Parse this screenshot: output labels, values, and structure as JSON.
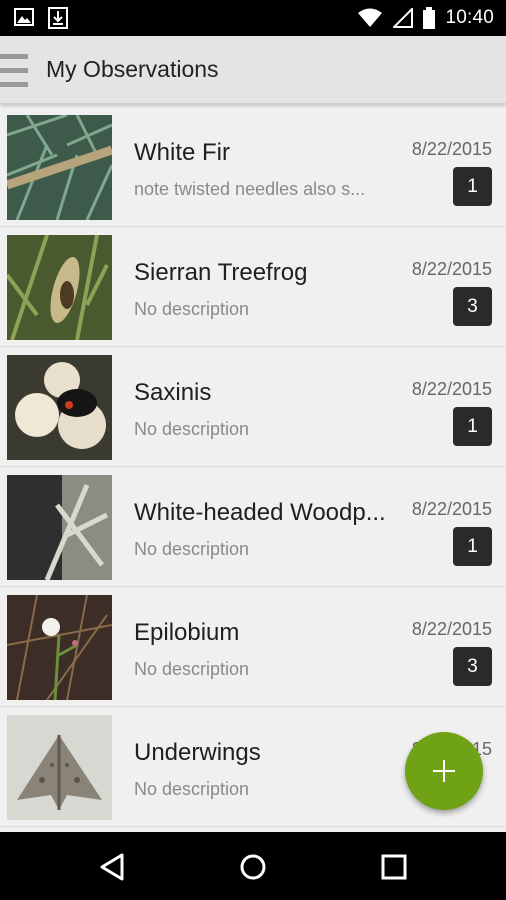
{
  "status_bar": {
    "time": "10:40",
    "left_icons": [
      "image-icon",
      "download-icon"
    ],
    "right_icons": [
      "wifi-icon",
      "signal-icon",
      "battery-icon"
    ]
  },
  "toolbar": {
    "title": "My Observations",
    "menu_icon": "hamburger-menu-icon"
  },
  "observations": [
    {
      "name": "White Fir",
      "description": "note twisted needles also s...",
      "date": "8/22/2015",
      "count": "1"
    },
    {
      "name": "Sierran Treefrog",
      "description": "No description",
      "date": "8/22/2015",
      "count": "3"
    },
    {
      "name": "Saxinis",
      "description": "No description",
      "date": "8/22/2015",
      "count": "1"
    },
    {
      "name": "White-headed Woodp...",
      "description": "No description",
      "date": "8/22/2015",
      "count": "1"
    },
    {
      "name": "Epilobium",
      "description": "No description",
      "date": "8/22/2015",
      "count": "3"
    },
    {
      "name": "Underwings",
      "description": "No description",
      "date": "8/22/2015",
      "count": ""
    }
  ],
  "fab": {
    "icon": "add-icon",
    "color": "#6fa214"
  },
  "nav_bar": {
    "icons": [
      "back-icon",
      "home-icon",
      "recents-icon"
    ]
  }
}
